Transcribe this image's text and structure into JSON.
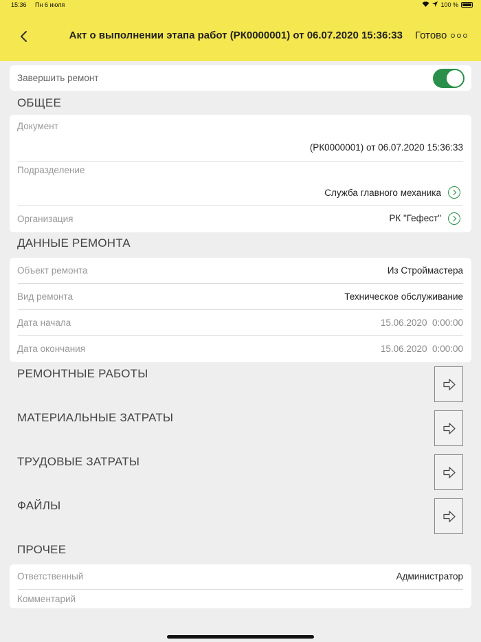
{
  "status_bar": {
    "time": "15:36",
    "date": "Пн 6 июля",
    "battery": "100 %"
  },
  "header": {
    "title": "Акт о выполнении этапа работ (РК0000001) от 06.07.2020 15:36:33",
    "done_label": "Готово"
  },
  "complete_repair": {
    "label": "Завершить ремонт",
    "enabled": true
  },
  "general": {
    "section_title": "ОБЩЕЕ",
    "document_label": "Документ",
    "document_value": "(РК0000001) от 06.07.2020 15:36:33",
    "department_label": "Подразделение",
    "department_value": "Служба главного механика",
    "organization_label": "Организация",
    "organization_value": "РК \"Гефест\""
  },
  "repair_data": {
    "section_title": "ДАННЫЕ РЕМОНТА",
    "object_label": "Объект ремонта",
    "object_value": "Из Строймастера",
    "type_label": "Вид ремонта",
    "type_value": "Техническое обслуживание",
    "start_label": "Дата начала",
    "start_value": "15.06.2020  0:00:00",
    "end_label": "Дата окончания",
    "end_value": "15.06.2020  0:00:00"
  },
  "repair_works": {
    "section_title": "РЕМОНТНЫЕ РАБОТЫ"
  },
  "material_costs": {
    "section_title": "МАТЕРИАЛЬНЫЕ ЗАТРАТЫ"
  },
  "labor_costs": {
    "section_title": "ТРУДОВЫЕ ЗАТРАТЫ"
  },
  "files": {
    "section_title": "ФАЙЛЫ"
  },
  "other": {
    "section_title": "ПРОЧЕЕ",
    "responsible_label": "Ответственный",
    "responsible_value": "Администратор",
    "comment_label": "Комментарий",
    "comment_value": ""
  },
  "colors": {
    "header_bg": "#f5e74f",
    "accent": "#2a8f4a",
    "page_bg": "#eeeeee"
  },
  "icons": [
    "back-chevron-icon",
    "more-dots-icon",
    "wifi-icon",
    "location-arrow-icon",
    "battery-icon",
    "circle-chevron-right-icon",
    "arrow-right-outline-icon"
  ]
}
